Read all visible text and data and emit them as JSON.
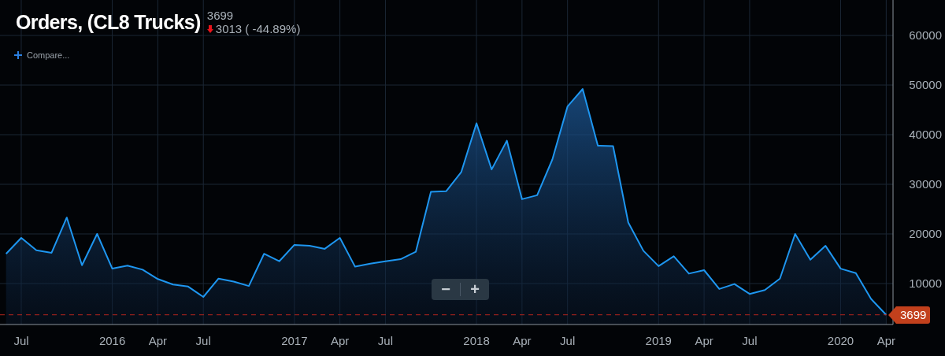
{
  "header": {
    "value": "3699",
    "change": "3013 ( -44.89%)"
  },
  "compare": {
    "label": "Compare..."
  },
  "zoom_controls": [
    {
      "label": "−"
    },
    {
      "label": "+"
    }
  ],
  "last_value_badge": "3699",
  "chart_data": {
    "type": "area",
    "ylim": [
      1746,
      67143
    ],
    "categories": [
      null,
      "Jul",
      null,
      null,
      null,
      null,
      null,
      "2016",
      null,
      null,
      "Apr",
      null,
      null,
      "Jul",
      null,
      null,
      null,
      null,
      null,
      "2017",
      null,
      null,
      "Apr",
      null,
      null,
      "Jul",
      null,
      null,
      null,
      null,
      null,
      "2018",
      null,
      null,
      "Apr",
      null,
      null,
      "Jul",
      null,
      null,
      null,
      null,
      null,
      "2019",
      null,
      null,
      "Apr",
      null,
      null,
      "Jul",
      null,
      null,
      null,
      null,
      null,
      "2020",
      null,
      null,
      "Apr"
    ],
    "series": [
      {
        "name": "Orders, (CL8 Trucks)",
        "color": "#1e96f0",
        "values": [
          16000,
          19200,
          16700,
          16200,
          23300,
          13700,
          20000,
          13000,
          13600,
          12800,
          10900,
          9800,
          9400,
          7300,
          11000,
          10400,
          9500,
          16000,
          14500,
          17800,
          17600,
          17000,
          19200,
          13400,
          14000,
          14500,
          14900,
          16400,
          28500,
          28600,
          32500,
          42300,
          33000,
          38800,
          27000,
          27800,
          35000,
          45700,
          49200,
          37800,
          37700,
          22300,
          16600,
          13500,
          15500,
          12000,
          12700,
          8900,
          9900,
          7900,
          8700,
          11000,
          20000,
          14800,
          17600,
          13000,
          12100,
          6900,
          3700
        ]
      }
    ],
    "yticks": [
      10000,
      20000,
      30000,
      40000,
      50000,
      60000
    ],
    "grid": true,
    "ref_lines": [
      {
        "axis": "y",
        "value": 3700,
        "color": "#b3261e"
      }
    ]
  }
}
